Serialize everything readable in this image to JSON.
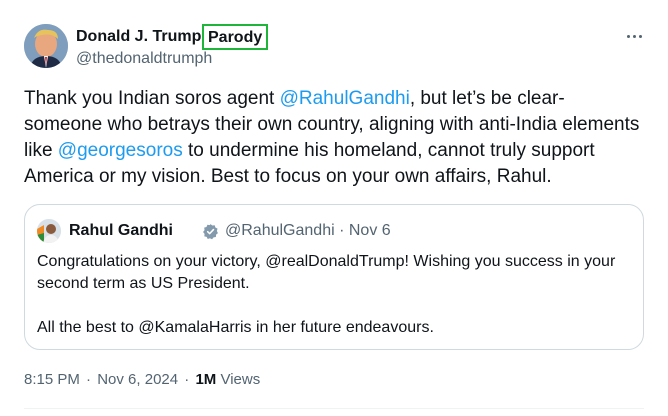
{
  "author": {
    "name": "Donald J. Trump",
    "badge": "Parody",
    "handle": "@thedonaldtrumph"
  },
  "tweet": {
    "text_1": "Thank you Indian soros agent ",
    "mention_1": "@RahulGandhi",
    "text_2": ", but let’s be clear- someone who betrays their own country, aligning with anti-India elements like ",
    "mention_2": "@georgesoros",
    "text_3": " to undermine his homeland, cannot truly support America or my vision. Best to focus on your own affairs, Rahul."
  },
  "quote": {
    "name": "Rahul Gandhi",
    "handle_date": "@RahulGandhi · Nov 6",
    "paragraph_1": "Congratulations on your victory, @realDonaldTrump! Wishing you success in your second term as US President.",
    "paragraph_2": "All the best to @KamalaHarris in her future endeavours."
  },
  "meta": {
    "time": "8:15 PM",
    "date": "Nov 6, 2024",
    "separator": "·",
    "views_count": "1M",
    "views_label": "Views"
  },
  "icons": {
    "more": "more-icon",
    "verified": "verified-badge-icon"
  },
  "colors": {
    "link": "#1d9bf0",
    "muted": "#536471",
    "highlight_box": "#1fb53a",
    "border": "#cfd9de"
  }
}
